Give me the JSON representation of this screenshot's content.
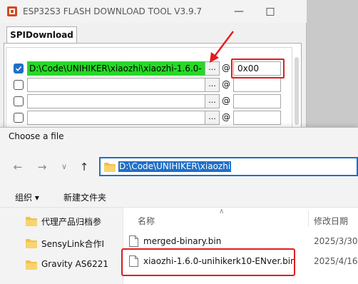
{
  "tool_window": {
    "title": "ESP32S3 FLASH DOWNLOAD TOOL V3.9.7",
    "tab_label": "SPIDownload",
    "rows": [
      {
        "checked": true,
        "path": "D:\\Code\\UNIHIKER\\xiaozhi\\xiaozhi-1.6.0-",
        "browse": "...",
        "at": "@",
        "address": "0x00"
      },
      {
        "checked": false,
        "path": "",
        "browse": "...",
        "at": "@",
        "address": ""
      },
      {
        "checked": false,
        "path": "",
        "browse": "...",
        "at": "@",
        "address": ""
      },
      {
        "checked": false,
        "path": "",
        "browse": "...",
        "at": "@",
        "address": ""
      }
    ]
  },
  "dialog": {
    "title": "Choose a file",
    "address_path": "D:\\Code\\UNIHIKER\\xiaozhi",
    "commands": {
      "organize": "组织 ▾",
      "new_folder": "新建文件夹"
    },
    "nav_items": [
      "代理产品归档参",
      "SensyLink合作I",
      "Gravity AS6221"
    ],
    "columns": {
      "name": "名称",
      "modified": "修改日期"
    },
    "files": [
      {
        "name": "merged-binary.bin",
        "date": "2025/3/30"
      },
      {
        "name": "xiaozhi-1.6.0-unihikerk10-ENver.bin",
        "date": "2025/4/16"
      }
    ]
  },
  "colors": {
    "highlight_green": "#27d827",
    "annotation_red": "#e41d1d",
    "accent_blue": "#1f6fc6"
  }
}
